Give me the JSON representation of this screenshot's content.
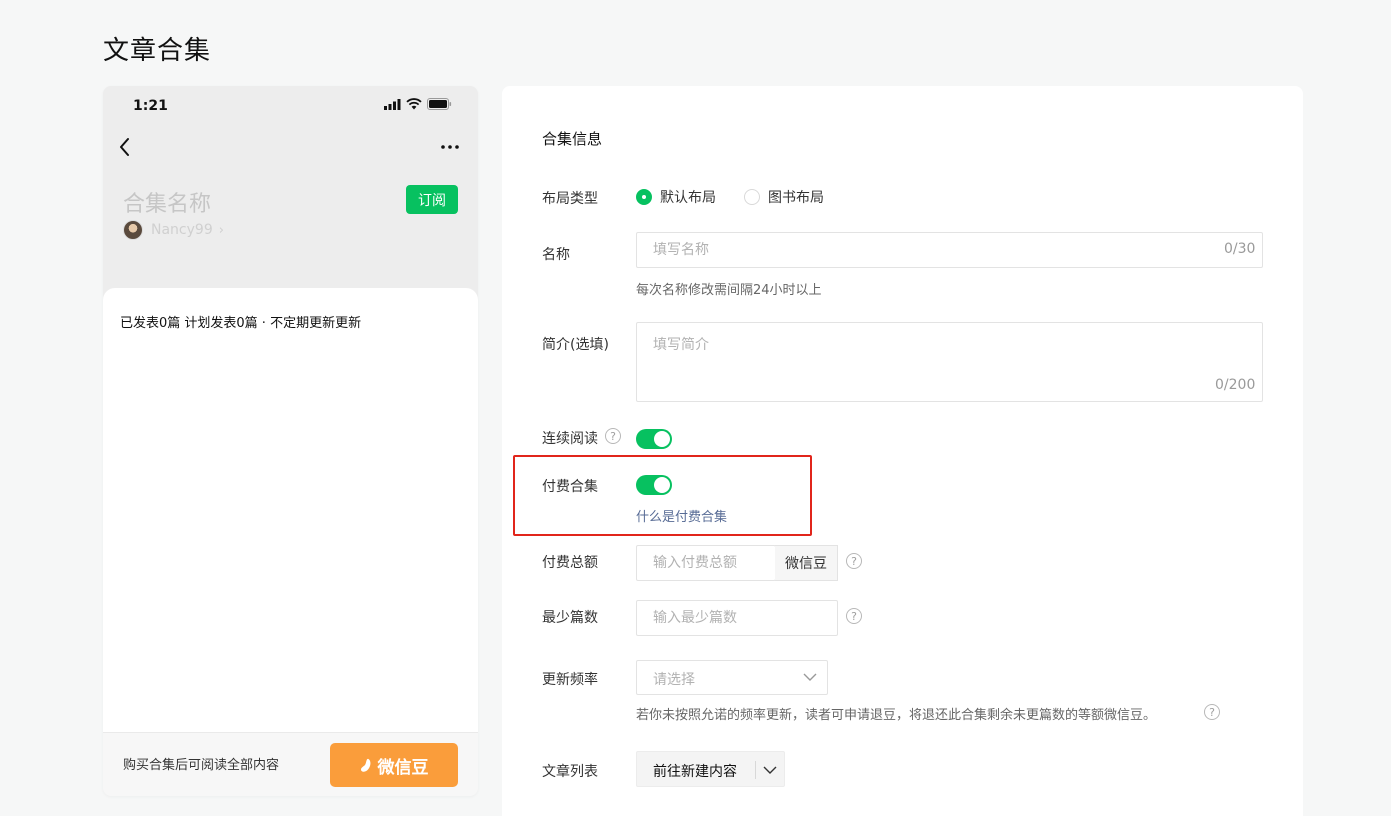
{
  "page": {
    "title": "文章合集"
  },
  "phone": {
    "time": "1:21",
    "collection_name": "合集名称",
    "author": "Nancy99",
    "author_chevron": "›",
    "subscribe_label": "订阅",
    "publish_info": "已发表0篇 计划发表0篇 · 不定期更新更新",
    "purchase_hint": "购买合集后可阅读全部内容",
    "bean_button_label": "微信豆"
  },
  "form": {
    "section_title": "合集信息",
    "layout": {
      "label": "布局类型",
      "options": [
        {
          "label": "默认布局",
          "checked": true
        },
        {
          "label": "图书布局",
          "checked": false
        }
      ]
    },
    "name": {
      "label": "名称",
      "placeholder": "填写名称",
      "counter": "0/30",
      "hint": "每次名称修改需间隔24小时以上"
    },
    "intro": {
      "label": "简介(选填)",
      "placeholder": "填写简介",
      "counter": "0/200"
    },
    "continuous": {
      "label": "连续阅读",
      "help": "?",
      "enabled": true
    },
    "paid": {
      "label": "付费合集",
      "enabled": true,
      "link": "什么是付费合集"
    },
    "total": {
      "label": "付费总额",
      "placeholder": "输入付费总额",
      "unit": "微信豆",
      "help": "?"
    },
    "min_count": {
      "label": "最少篇数",
      "placeholder": "输入最少篇数",
      "help": "?"
    },
    "frequency": {
      "label": "更新频率",
      "value": "请选择",
      "hint": "若你未按照允诺的频率更新，读者可申请退豆，将退还此合集剩余未更篇数的等额微信豆。",
      "help": "?"
    },
    "articles": {
      "label": "文章列表",
      "button": "前往新建内容"
    }
  },
  "colors": {
    "brand_green": "#07c160",
    "bean_orange": "#fa9d3b",
    "highlight_red": "#e1251b",
    "link_blue": "#576b95"
  }
}
